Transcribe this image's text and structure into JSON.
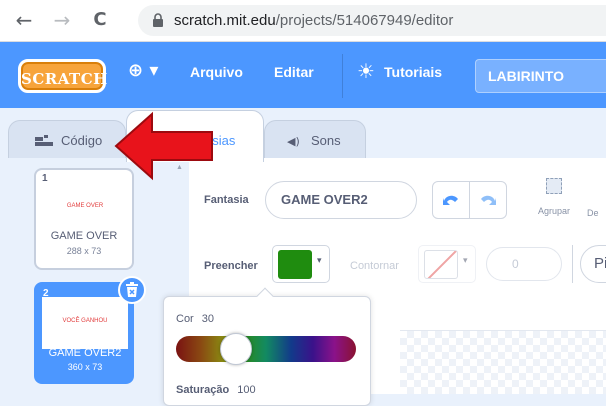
{
  "browser": {
    "back": "←",
    "forward": "→",
    "reload": "C",
    "lock": "🔒",
    "url_host": "scratch.mit.edu",
    "url_path": "/projects/514067949/editor"
  },
  "menu": {
    "logo": "SCRATCH",
    "language_icon": "⊕ ▾",
    "file": "Arquivo",
    "edit": "Editar",
    "tutorials_icon": "☀",
    "tutorials": "Tutoriais",
    "project_title": "LABIRINTO"
  },
  "tabs": [
    {
      "label": "Código",
      "icon": "code-icon"
    },
    {
      "label": "Fantasias",
      "visible_label": "asias",
      "icon": "costume-icon"
    },
    {
      "label": "Sons",
      "icon": "speaker-icon"
    }
  ],
  "costumes": [
    {
      "num": "1",
      "thumb_text": "GAME OVER",
      "name": "GAME OVER",
      "size": "288 x 73"
    },
    {
      "num": "2",
      "thumb_text": "VOCÊ GANHOU",
      "name": "GAME OVER2",
      "size": "360 x 73"
    }
  ],
  "editor": {
    "costume_label": "Fantasia",
    "costume_name": "GAME OVER2",
    "undo": "↶",
    "redo": "↷",
    "group_label": "Agrupar",
    "ungroup_label": "De",
    "fill_label": "Preencher",
    "fill_color": "#1f8c0f",
    "outline_label": "Contornar",
    "outline_width": "0",
    "brush_size": "Pi"
  },
  "color_popup": {
    "color_label": "Cor",
    "color_value": "30",
    "saturation_label": "Saturação",
    "saturation_value": "100"
  },
  "icons": {
    "caret": "▾",
    "delete": "🗑",
    "speaker": "◀)",
    "code": "▬"
  }
}
